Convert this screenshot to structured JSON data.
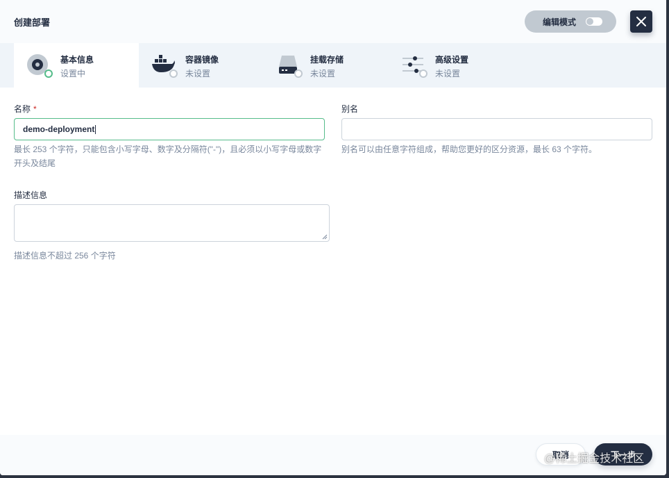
{
  "header": {
    "title": "创建部署",
    "edit_mode_label": "编辑模式"
  },
  "tabs": [
    {
      "name": "基本信息",
      "status": "设置中",
      "icon": "basic-info-icon"
    },
    {
      "name": "容器镜像",
      "status": "未设置",
      "icon": "docker-icon"
    },
    {
      "name": "挂载存储",
      "status": "未设置",
      "icon": "storage-icon"
    },
    {
      "name": "高级设置",
      "status": "未设置",
      "icon": "settings-sliders-icon"
    }
  ],
  "form": {
    "name_label": "名称",
    "name_required_mark": "*",
    "name_value": "demo-deployment",
    "name_hint": "最长 253 个字符，只能包含小写字母、数字及分隔符(\"-\")，且必须以小写字母或数字开头及结尾",
    "alias_label": "别名",
    "alias_value": "",
    "alias_hint": "别名可以由任意字符组成，帮助您更好的区分资源，最长 63 个字符。",
    "description_label": "描述信息",
    "description_value": "",
    "description_hint": "描述信息不超过 256 个字符"
  },
  "footer": {
    "cancel_label": "取消",
    "next_label": "下一步"
  },
  "watermark": "@稀土掘金技术社区",
  "colors": {
    "primary_dark": "#242e42",
    "success": "#55bc8a",
    "required": "#ca2621",
    "muted_text": "#79879c"
  }
}
